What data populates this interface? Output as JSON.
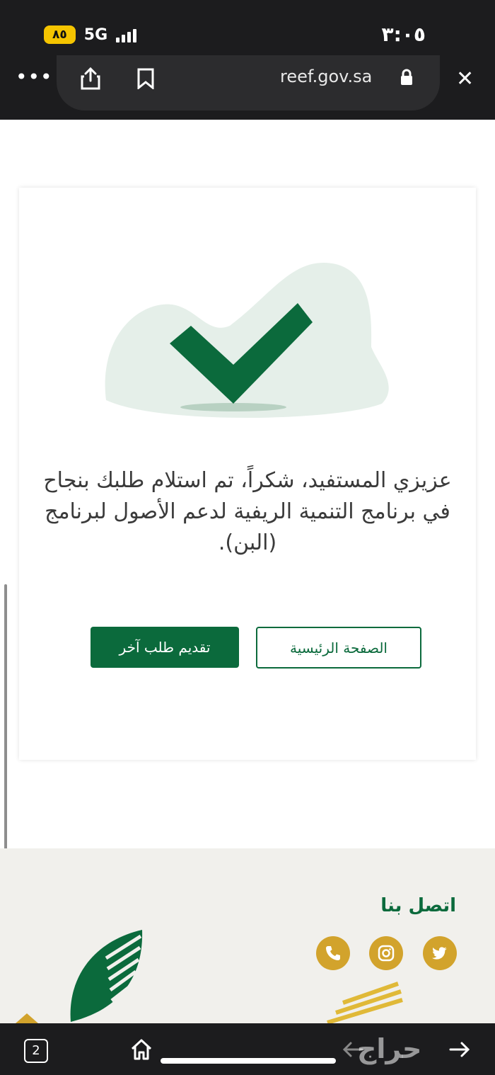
{
  "status_bar": {
    "time": "٣:٠٥",
    "battery": "٨٥",
    "network": "5G"
  },
  "browser": {
    "url": "reef.gov.sa",
    "tab_count": "2",
    "more_glyph": "•••",
    "close_glyph": "✕"
  },
  "confirmation": {
    "message": "عزيزي المستفيد، شكراً، تم استلام طلبك بنجاح في برنامج التنمية الريفية لدعم الأصول لبرنامج (البن).",
    "new_request_button": "تقديم طلب آخر",
    "home_button": "الصفحة الرئيسية"
  },
  "footer": {
    "contact_title": "اتصل بنا",
    "social_icons": [
      "twitter-icon",
      "instagram-icon",
      "phone-icon"
    ]
  },
  "watermark": "حراج",
  "colors": {
    "brand_green": "#0b6a3c",
    "gold": "#d2a32c",
    "bar_dark": "#1c1c1e",
    "footer_bg": "#f1f0ec"
  }
}
